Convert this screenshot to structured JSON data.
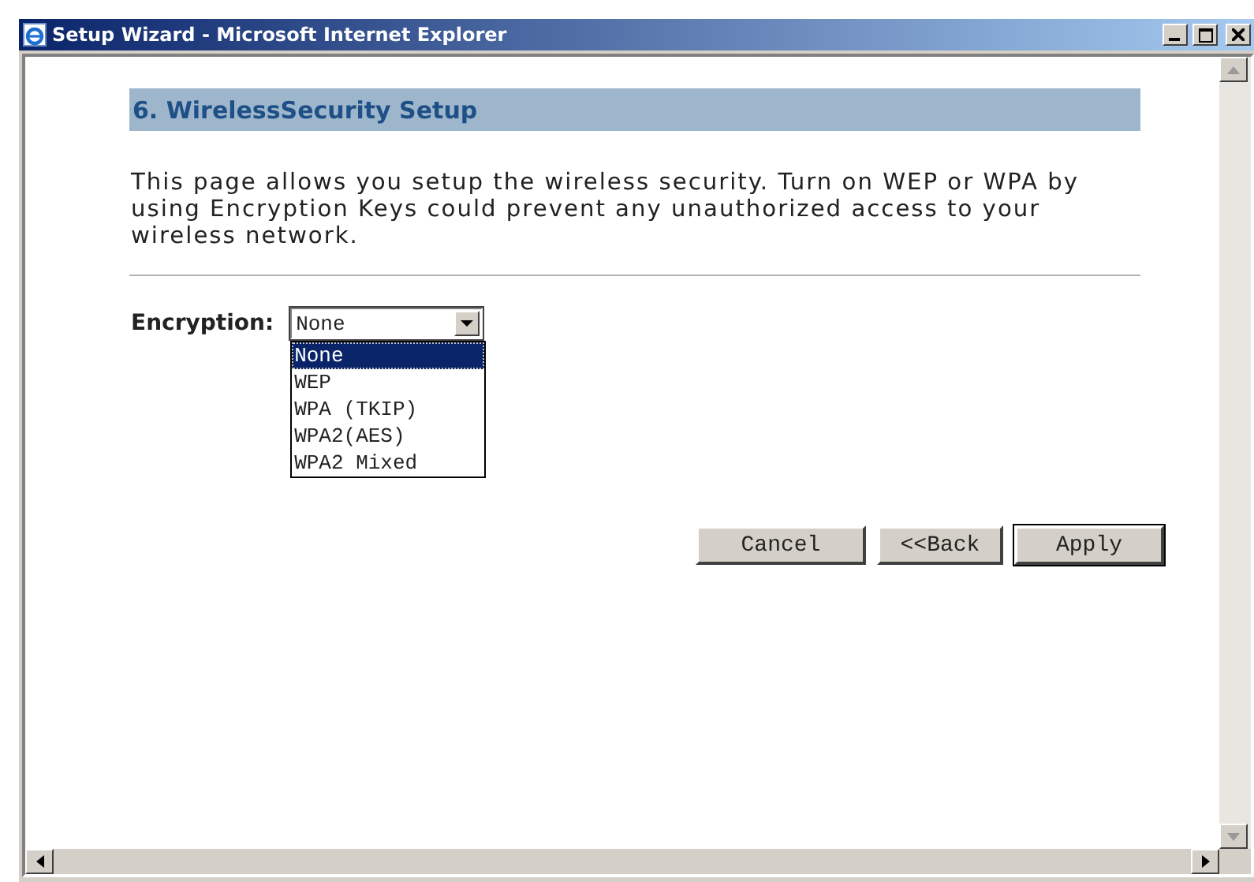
{
  "window": {
    "title": "Setup Wizard - Microsoft Internet Explorer"
  },
  "page": {
    "heading": "6. WirelessSecurity Setup",
    "description": "This page allows you setup the wireless security. Turn on WEP or WPA by using Encryption Keys could prevent any unauthorized access to your wireless network.",
    "encryption": {
      "label": "Encryption:",
      "value": "None",
      "expanded": true,
      "options": [
        {
          "label": "None",
          "selected": true
        },
        {
          "label": "WEP",
          "selected": false
        },
        {
          "label": "WPA (TKIP)",
          "selected": false
        },
        {
          "label": "WPA2(AES)",
          "selected": false
        },
        {
          "label": "WPA2 Mixed",
          "selected": false
        }
      ]
    },
    "buttons": [
      {
        "label": "Cancel",
        "default": false
      },
      {
        "label": "<<Back",
        "default": false
      },
      {
        "label": "Apply",
        "default": true
      }
    ]
  }
}
